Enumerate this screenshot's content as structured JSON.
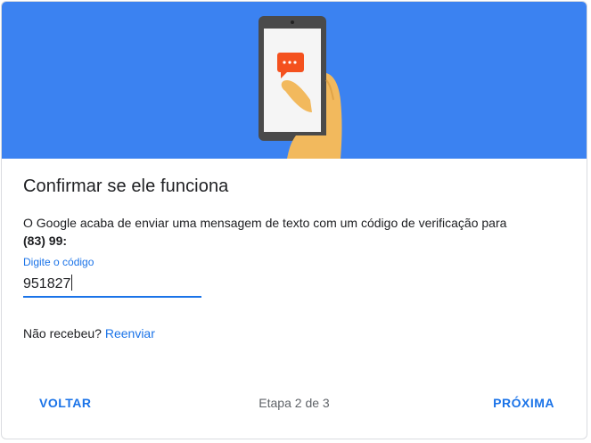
{
  "hero": {
    "illustration": "phone-with-sms-icon",
    "background_color": "#3b82f1"
  },
  "dialog": {
    "title": "Confirmar se ele funciona",
    "description": "O Google acaba de enviar uma mensagem de texto com um código de verificação para",
    "phone_number": "(83) 99:"
  },
  "code_field": {
    "label": "Digite o código",
    "value": "951827"
  },
  "resend": {
    "prompt": "Não recebeu?",
    "link": "Reenviar"
  },
  "footer": {
    "back_label": "VOLTAR",
    "step_text": "Etapa 2 de 3",
    "next_label": "PRÓXIMA"
  },
  "colors": {
    "accent": "#1a73e8",
    "text": "#202124"
  }
}
